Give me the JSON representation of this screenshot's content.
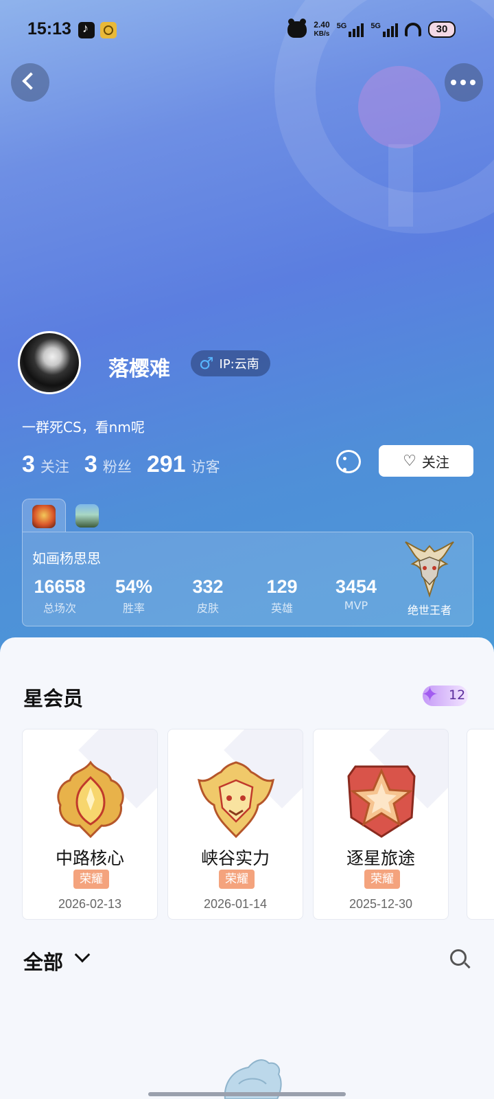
{
  "status_bar": {
    "time": "15:13",
    "net_speed": "2.40",
    "net_unit": "KB/s",
    "sig1": "5G",
    "sig2": "5G",
    "battery": "30"
  },
  "icons": {
    "back": "chevron-left-icon",
    "more": "more-dots-icon",
    "gender": "male-icon",
    "chat": "chat-bubble-icon",
    "heart": "heart-icon",
    "search": "search-icon",
    "dropdown": "chevron-down-icon"
  },
  "profile": {
    "username": "落樱难",
    "gender_symbol": "♂",
    "ip": "IP:云南",
    "bio": "一群死CS，看nm呢",
    "following_count": "3",
    "following_label": "关注",
    "fans_count": "3",
    "fans_label": "粉丝",
    "visitors_count": "291",
    "visitors_label": "访客",
    "follow_button": "关注"
  },
  "game": {
    "character_name": "如画杨思思",
    "stats": [
      {
        "value": "16658",
        "label": "总场次"
      },
      {
        "value": "54%",
        "label": "胜率"
      },
      {
        "value": "332",
        "label": "皮肤"
      },
      {
        "value": "129",
        "label": "英雄"
      },
      {
        "value": "3454",
        "label": "MVP"
      }
    ],
    "rank": "绝世王者"
  },
  "membership": {
    "title": "星会员",
    "level": "12",
    "medals": [
      {
        "name": "中路核心",
        "tag": "荣耀",
        "date": "2026-02-13"
      },
      {
        "name": "峡谷实力",
        "tag": "荣耀",
        "date": "2026-01-14"
      },
      {
        "name": "逐星旅途",
        "tag": "荣耀",
        "date": "2025-12-30"
      }
    ]
  },
  "filter": {
    "label": "全部"
  },
  "colors": {
    "hero_gradient_top": "#8fb3ec",
    "hero_gradient_bottom": "#4a9ad8",
    "tag_orange": "#f4a37d",
    "gender_blue": "#58b6ff"
  }
}
